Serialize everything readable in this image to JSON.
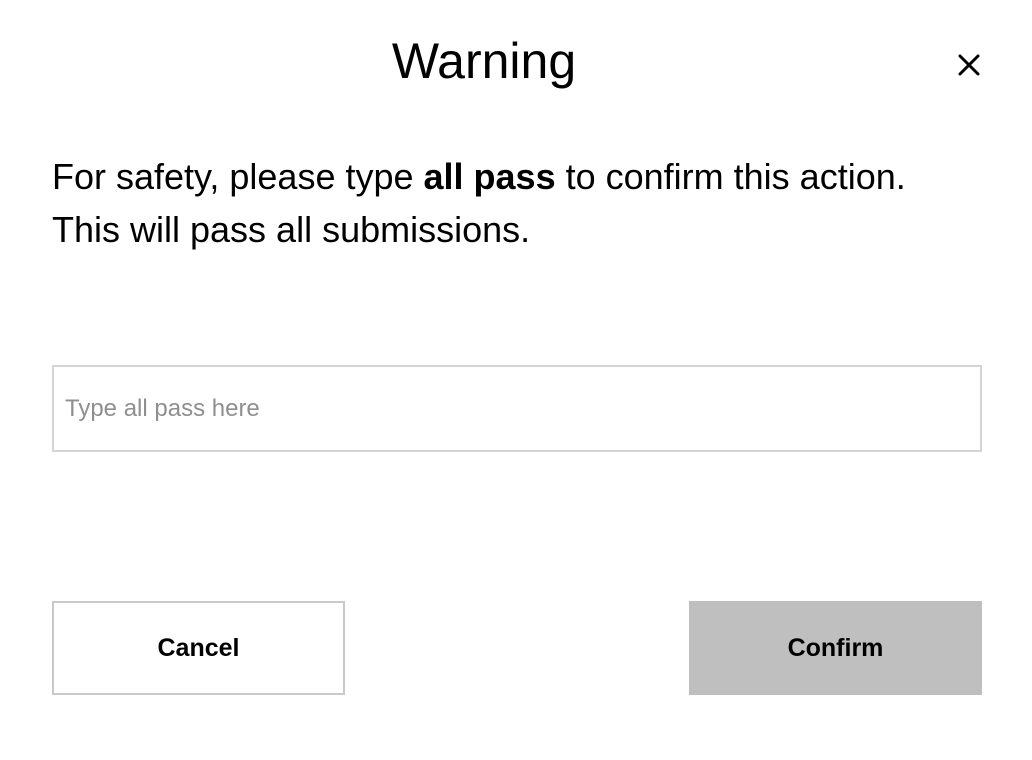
{
  "dialog": {
    "title": "Warning",
    "close_icon": "close-icon",
    "message_before": "For safety, please type ",
    "message_keyword": "all pass",
    "message_after": " to confirm this action. This will pass all submissions."
  },
  "input": {
    "value": "",
    "placeholder": "Type all pass here"
  },
  "buttons": {
    "cancel_label": "Cancel",
    "confirm_label": "Confirm"
  },
  "colors": {
    "confirm_background": "#bfbfbf",
    "input_border": "#d4d4d4",
    "placeholder": "#8f8f8f"
  }
}
